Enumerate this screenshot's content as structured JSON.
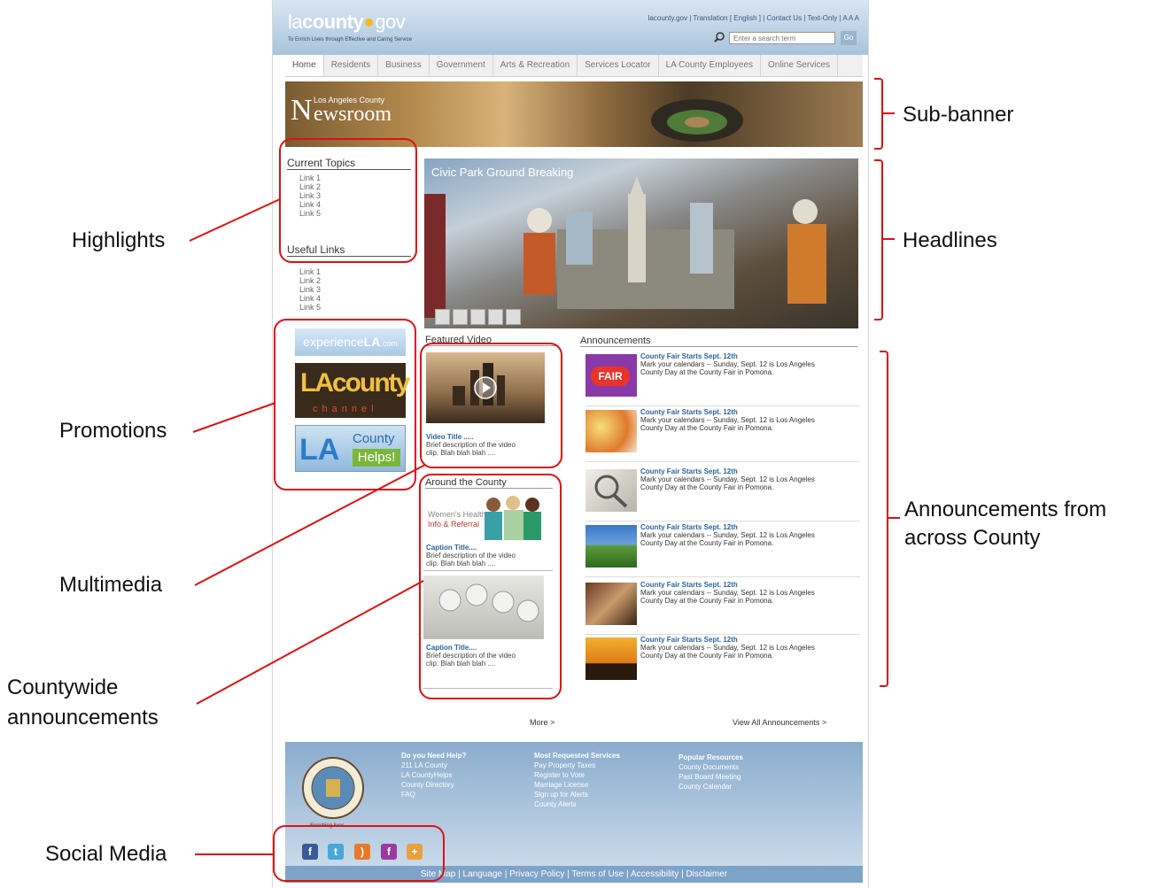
{
  "header": {
    "logo_a": "la",
    "logo_b": "county",
    "logo_c": "gov",
    "tagline": "To Enrich Lives through Effective and Caring Service",
    "top_links": "lacounty.gov | Translation [ English ] | Contact Us | Text-Only | A A A",
    "search_placeholder": "Enter a search term",
    "go_label": "Go"
  },
  "nav": {
    "tabs": [
      "Home",
      "Residents",
      "Business",
      "Government",
      "Arts & Recreation",
      "Services Locator",
      "LA County Employees",
      "Online Services"
    ]
  },
  "subbanner": {
    "small": "Los Angeles County",
    "title_n": "N",
    "title_rest": "ewsroom"
  },
  "sidebar": {
    "current_topics": "Current Topics",
    "current_links": [
      "Link 1",
      "Link 2",
      "Link 3",
      "Link 4",
      "Link 5"
    ],
    "useful_links": "Useful Links",
    "useful_link_items": [
      "Link 1",
      "Link 2",
      "Link 3",
      "Link 4",
      "Link 5"
    ],
    "promo_experience_a": "experience",
    "promo_experience_b": "LA",
    "promo_experience_c": ".com",
    "promo_channel_a": "LA",
    "promo_channel_b": "county",
    "promo_channel_c": "channel",
    "promo_helps_a": "LA",
    "promo_helps_b": "County",
    "promo_helps_c": "Helps!"
  },
  "headline": {
    "title": "Civic Park Ground Breaking"
  },
  "featured_video": {
    "heading": "Featured Video",
    "title": "Video Title .....",
    "desc1": "Brief description of the video",
    "desc2": "clip. Blah blah blah ...."
  },
  "around": {
    "heading": "Around the County",
    "img1_a": "Women's Health",
    "img1_b": "Info & Referral",
    "caption1": "Caption Title....",
    "caption1_desc1": "Brief description of the video",
    "caption1_desc2": "clip. Blah blah blah ....",
    "caption2": "Caption Title....",
    "caption2_desc1": "Brief description of the video",
    "caption2_desc2": "clip. Blah blah blah ...."
  },
  "announcements": {
    "heading": "Announcements",
    "fair_badge": "FAIR",
    "items": [
      {
        "title": "County Fair Starts Sept. 12th",
        "desc1": "Mark your calendars -- Sunday, Sept. 12 is Los Angeles",
        "desc2": "County Day at the County Fair in Pomona."
      },
      {
        "title": "County Fair Starts Sept. 12th",
        "desc1": "Mark your calendars -- Sunday, Sept. 12 is Los Angeles",
        "desc2": "County Day at the County Fair in Pomona."
      },
      {
        "title": "County Fair Starts Sept. 12th",
        "desc1": "Mark your calendars -- Sunday, Sept. 12 is Los Angeles",
        "desc2": "County Day at the County Fair in Pomona."
      },
      {
        "title": "County Fair Starts Sept. 12th",
        "desc1": "Mark your calendars -- Sunday, Sept. 12 is Los Angeles",
        "desc2": "County Day at the County Fair in Pomona."
      },
      {
        "title": "County Fair Starts Sept. 12th",
        "desc1": "Mark your calendars -- Sunday, Sept. 12 is Los Angeles",
        "desc2": "County Day at the County Fair in Pomona."
      },
      {
        "title": "County Fair Starts Sept. 12th",
        "desc1": "Mark your calendars -- Sunday, Sept. 12 is Los Angeles",
        "desc2": "County Day at the County Fair in Pomona."
      }
    ],
    "more": "More >",
    "view_all": "View All Announcements >"
  },
  "footer": {
    "seal_caption": "Enriching lives...",
    "col1_head": "Do you Need Help?",
    "col1": [
      "211 LA County",
      "LA CountyHelps",
      "County Directory",
      "FAQ"
    ],
    "col2_head": "Most Requested Services",
    "col2": [
      "Pay Property Taxes",
      "Register to Vote",
      "Marriage License",
      "Sign up for Alerts",
      "County Alerts"
    ],
    "col3_head": "Popular Resources",
    "col3": [
      "County Documents",
      "Past Board Meeting",
      "County Calendar"
    ],
    "bottom_links": "Site Map  |  Language  |  Privacy Policy  |  Terms of Use  |  Accessibility  |  Disclaimer"
  },
  "annotations": {
    "subbanner": "Sub-banner",
    "headlines": "Headlines",
    "highlights": "Highlights",
    "promotions": "Promotions",
    "multimedia": "Multimedia",
    "announcements_line1": "Announcements from",
    "announcements_line2": "across County",
    "countywide_line1": "Countywide",
    "countywide_line2": "announcements",
    "social": "Social Media"
  },
  "colors": {
    "annotation_red": "#e01010",
    "link_blue": "#2a64a0",
    "header_blue": "#a9c3dc"
  }
}
